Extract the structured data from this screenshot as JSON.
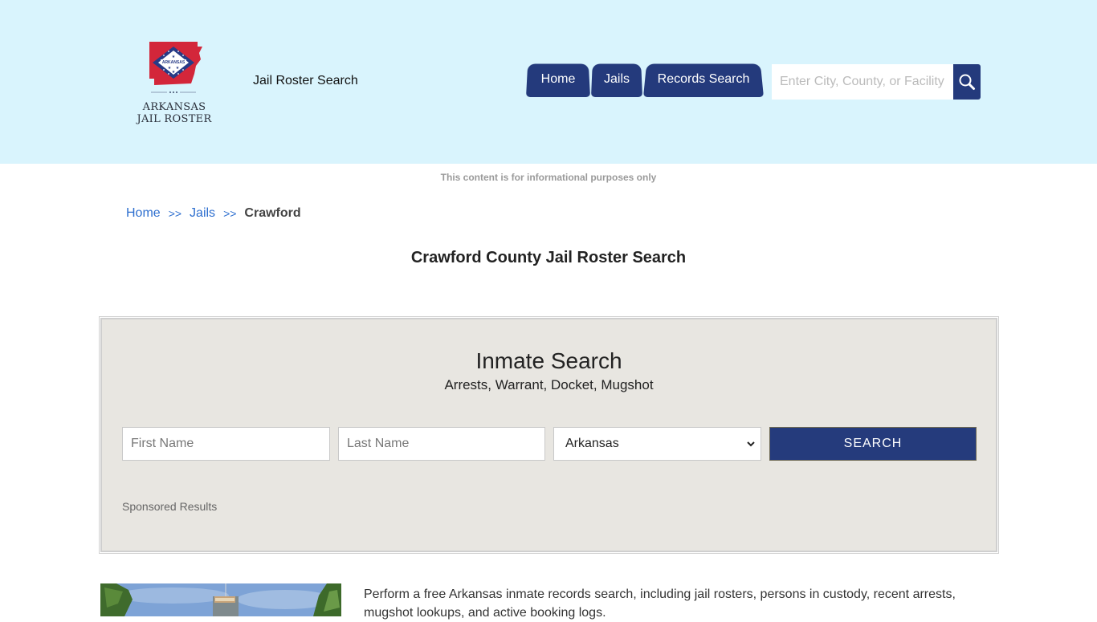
{
  "header": {
    "logo": {
      "badge_text": "ARKANSAS",
      "line1": "ARKANSAS",
      "line2": "JAIL ROSTER"
    },
    "site_title": "Jail Roster Search",
    "nav": [
      {
        "label": "Home"
      },
      {
        "label": "Jails"
      },
      {
        "label": "Records Search"
      }
    ],
    "search": {
      "placeholder": "Enter City, County, or Facility",
      "value": "",
      "icon": "search-icon"
    }
  },
  "disclaimer": "This content is for informational purposes only",
  "breadcrumb": {
    "items": [
      {
        "label": "Home"
      },
      {
        "label": "Jails"
      }
    ],
    "separator": ">>",
    "current": "Crawford"
  },
  "page_title": "Crawford County Jail Roster Search",
  "inmate_search": {
    "title": "Inmate Search",
    "subtitle": "Arrests, Warrant, Docket, Mugshot",
    "first_name_placeholder": "First Name",
    "last_name_placeholder": "Last Name",
    "state_selected": "Arkansas",
    "search_button": "SEARCH",
    "sponsored_label": "Sponsored Results"
  },
  "intro_text": "Perform a free Arkansas inmate records search, including jail rosters, persons in custody, recent arrests, mugshot lookups, and active booking logs.",
  "colors": {
    "header_bg": "#d9f4fd",
    "nav_bg": "#243a7c",
    "link": "#2e6fcf",
    "panel_bg": "#e8e6e1"
  }
}
